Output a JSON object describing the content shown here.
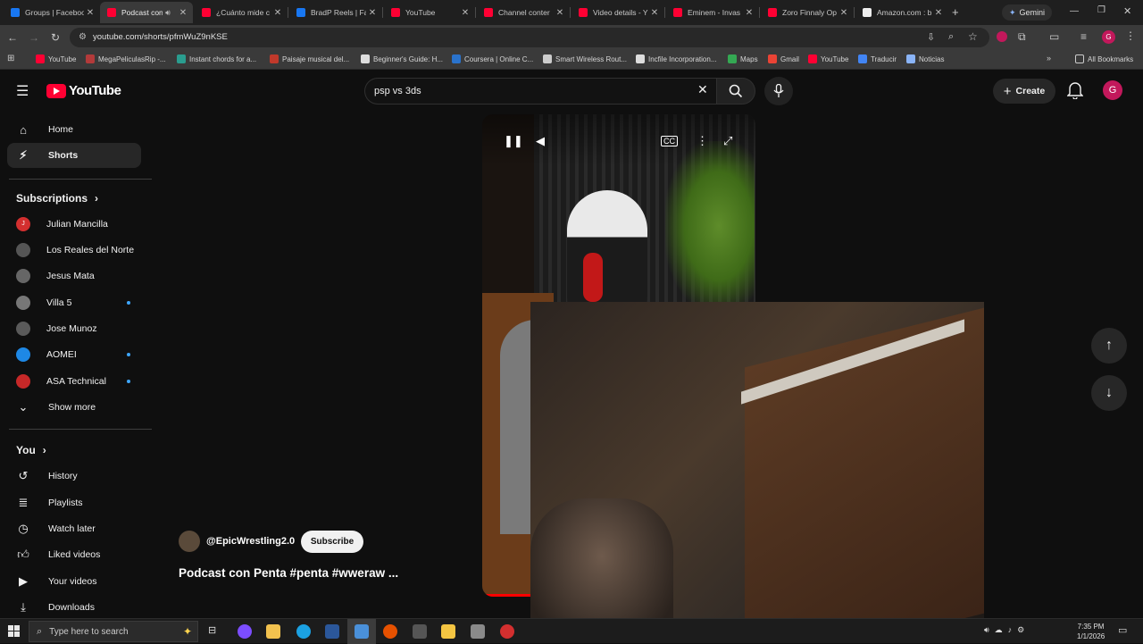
{
  "browser": {
    "tabs": [
      {
        "title": "Groups | Facebook",
        "color": "#1877f2"
      },
      {
        "title": "Podcast con Penta",
        "color": "#ff0033"
      },
      {
        "title": "¿Cuánto mide c",
        "color": "#ff0033"
      },
      {
        "title": "BradP Reels | Fa",
        "color": "#1877f2"
      },
      {
        "title": "YouTube",
        "color": "#ff0033"
      },
      {
        "title": "Channel conter",
        "color": "#ff0033"
      },
      {
        "title": "Video details - Y",
        "color": "#ff0033"
      },
      {
        "title": "Eminem - Invas",
        "color": "#ff0033"
      },
      {
        "title": "Zoro Finnaly Op",
        "color": "#ff0033"
      },
      {
        "title": "Amazon.com : b",
        "color": "#eeeeee"
      }
    ],
    "gemini_label": "Gemini",
    "url": "youtube.com/shorts/pfmWuZ9nKSE",
    "bookmarks": [
      {
        "label": "YouTube",
        "color": "#ff0033"
      },
      {
        "label": "MegaPeliculasRip -...",
        "color": "#b33a3a"
      },
      {
        "label": "Instant chords for a...",
        "color": "#2a9d8f"
      },
      {
        "label": "Paisaje musical del...",
        "color": "#c0392b"
      },
      {
        "label": "Beginner's Guide: H...",
        "color": "#dddddd"
      },
      {
        "label": "Coursera | Online C...",
        "color": "#2a73cc"
      },
      {
        "label": "Smart Wireless Rout...",
        "color": "#cccccc"
      },
      {
        "label": "Incfile Incorporation...",
        "color": "#dddddd"
      },
      {
        "label": "Maps",
        "color": "#34a853"
      },
      {
        "label": "Gmail",
        "color": "#ea4335"
      },
      {
        "label": "YouTube",
        "color": "#ff0033"
      },
      {
        "label": "Traducir",
        "color": "#4285f4"
      },
      {
        "label": "Noticias",
        "color": "#8ab4f8"
      }
    ],
    "all_bookmarks_label": "All Bookmarks"
  },
  "youtube": {
    "logo_text": "YouTube",
    "search_value": "psp vs 3ds",
    "create_label": "Create",
    "avatar_letter": "G"
  },
  "sidebar": {
    "main": [
      {
        "label": "Home",
        "icon": "home-icon"
      },
      {
        "label": "Shorts",
        "icon": "shorts-icon"
      }
    ],
    "subscriptions_heading": "Subscriptions",
    "subscriptions": [
      {
        "label": "Julian Mancilla",
        "color": "#d32f2f",
        "initial": "J",
        "dot": false
      },
      {
        "label": "Los Reales del Norte",
        "color": "#555555",
        "initial": "",
        "dot": false
      },
      {
        "label": "Jesus Mata",
        "color": "#666666",
        "initial": "",
        "dot": false
      },
      {
        "label": "Villa 5",
        "color": "#777777",
        "initial": "",
        "dot": true
      },
      {
        "label": "Jose Munoz",
        "color": "#5a5a5a",
        "initial": "",
        "dot": false
      },
      {
        "label": "AOMEI",
        "color": "#1e88e5",
        "initial": "",
        "dot": true
      },
      {
        "label": "ASA Technical",
        "color": "#c62828",
        "initial": "",
        "dot": true
      }
    ],
    "show_more_label": "Show more",
    "you_heading": "You",
    "you_items": [
      {
        "label": "History",
        "icon": "history-icon"
      },
      {
        "label": "Playlists",
        "icon": "playlists-icon"
      },
      {
        "label": "Watch later",
        "icon": "watch-later-icon"
      },
      {
        "label": "Liked videos",
        "icon": "like-icon"
      },
      {
        "label": "Your videos",
        "icon": "your-videos-icon"
      },
      {
        "label": "Downloads",
        "icon": "download-icon"
      }
    ]
  },
  "short": {
    "channel": "@EpicWrestling2.0",
    "subscribe_label": "Subscribe",
    "title": "Podcast con Penta #penta #wweraw ..."
  },
  "taskbar": {
    "search_placeholder": "Type here to search",
    "time": "7:35 PM",
    "date": "1/1/2026"
  }
}
